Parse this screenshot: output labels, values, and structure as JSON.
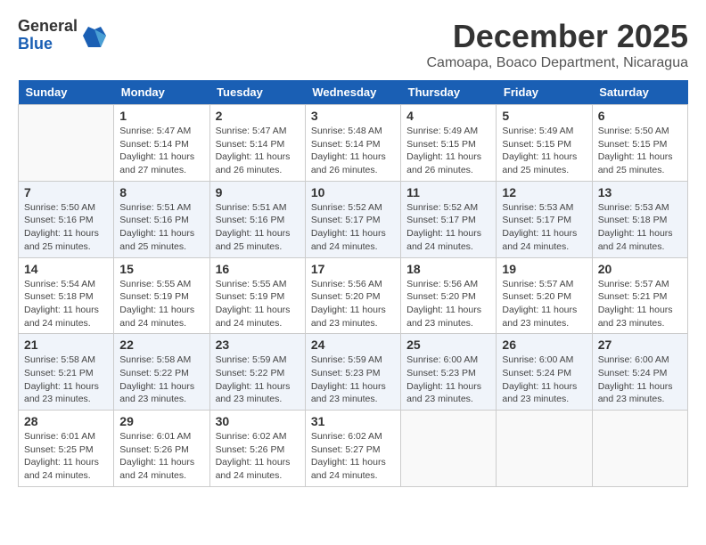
{
  "header": {
    "logo_general": "General",
    "logo_blue": "Blue",
    "month_title": "December 2025",
    "location": "Camoapa, Boaco Department, Nicaragua"
  },
  "weekdays": [
    "Sunday",
    "Monday",
    "Tuesday",
    "Wednesday",
    "Thursday",
    "Friday",
    "Saturday"
  ],
  "weeks": [
    [
      {
        "day": "",
        "info": ""
      },
      {
        "day": "1",
        "info": "Sunrise: 5:47 AM\nSunset: 5:14 PM\nDaylight: 11 hours\nand 27 minutes."
      },
      {
        "day": "2",
        "info": "Sunrise: 5:47 AM\nSunset: 5:14 PM\nDaylight: 11 hours\nand 26 minutes."
      },
      {
        "day": "3",
        "info": "Sunrise: 5:48 AM\nSunset: 5:14 PM\nDaylight: 11 hours\nand 26 minutes."
      },
      {
        "day": "4",
        "info": "Sunrise: 5:49 AM\nSunset: 5:15 PM\nDaylight: 11 hours\nand 26 minutes."
      },
      {
        "day": "5",
        "info": "Sunrise: 5:49 AM\nSunset: 5:15 PM\nDaylight: 11 hours\nand 25 minutes."
      },
      {
        "day": "6",
        "info": "Sunrise: 5:50 AM\nSunset: 5:15 PM\nDaylight: 11 hours\nand 25 minutes."
      }
    ],
    [
      {
        "day": "7",
        "info": "Sunrise: 5:50 AM\nSunset: 5:16 PM\nDaylight: 11 hours\nand 25 minutes."
      },
      {
        "day": "8",
        "info": "Sunrise: 5:51 AM\nSunset: 5:16 PM\nDaylight: 11 hours\nand 25 minutes."
      },
      {
        "day": "9",
        "info": "Sunrise: 5:51 AM\nSunset: 5:16 PM\nDaylight: 11 hours\nand 25 minutes."
      },
      {
        "day": "10",
        "info": "Sunrise: 5:52 AM\nSunset: 5:17 PM\nDaylight: 11 hours\nand 24 minutes."
      },
      {
        "day": "11",
        "info": "Sunrise: 5:52 AM\nSunset: 5:17 PM\nDaylight: 11 hours\nand 24 minutes."
      },
      {
        "day": "12",
        "info": "Sunrise: 5:53 AM\nSunset: 5:17 PM\nDaylight: 11 hours\nand 24 minutes."
      },
      {
        "day": "13",
        "info": "Sunrise: 5:53 AM\nSunset: 5:18 PM\nDaylight: 11 hours\nand 24 minutes."
      }
    ],
    [
      {
        "day": "14",
        "info": "Sunrise: 5:54 AM\nSunset: 5:18 PM\nDaylight: 11 hours\nand 24 minutes."
      },
      {
        "day": "15",
        "info": "Sunrise: 5:55 AM\nSunset: 5:19 PM\nDaylight: 11 hours\nand 24 minutes."
      },
      {
        "day": "16",
        "info": "Sunrise: 5:55 AM\nSunset: 5:19 PM\nDaylight: 11 hours\nand 24 minutes."
      },
      {
        "day": "17",
        "info": "Sunrise: 5:56 AM\nSunset: 5:20 PM\nDaylight: 11 hours\nand 23 minutes."
      },
      {
        "day": "18",
        "info": "Sunrise: 5:56 AM\nSunset: 5:20 PM\nDaylight: 11 hours\nand 23 minutes."
      },
      {
        "day": "19",
        "info": "Sunrise: 5:57 AM\nSunset: 5:20 PM\nDaylight: 11 hours\nand 23 minutes."
      },
      {
        "day": "20",
        "info": "Sunrise: 5:57 AM\nSunset: 5:21 PM\nDaylight: 11 hours\nand 23 minutes."
      }
    ],
    [
      {
        "day": "21",
        "info": "Sunrise: 5:58 AM\nSunset: 5:21 PM\nDaylight: 11 hours\nand 23 minutes."
      },
      {
        "day": "22",
        "info": "Sunrise: 5:58 AM\nSunset: 5:22 PM\nDaylight: 11 hours\nand 23 minutes."
      },
      {
        "day": "23",
        "info": "Sunrise: 5:59 AM\nSunset: 5:22 PM\nDaylight: 11 hours\nand 23 minutes."
      },
      {
        "day": "24",
        "info": "Sunrise: 5:59 AM\nSunset: 5:23 PM\nDaylight: 11 hours\nand 23 minutes."
      },
      {
        "day": "25",
        "info": "Sunrise: 6:00 AM\nSunset: 5:23 PM\nDaylight: 11 hours\nand 23 minutes."
      },
      {
        "day": "26",
        "info": "Sunrise: 6:00 AM\nSunset: 5:24 PM\nDaylight: 11 hours\nand 23 minutes."
      },
      {
        "day": "27",
        "info": "Sunrise: 6:00 AM\nSunset: 5:24 PM\nDaylight: 11 hours\nand 23 minutes."
      }
    ],
    [
      {
        "day": "28",
        "info": "Sunrise: 6:01 AM\nSunset: 5:25 PM\nDaylight: 11 hours\nand 24 minutes."
      },
      {
        "day": "29",
        "info": "Sunrise: 6:01 AM\nSunset: 5:26 PM\nDaylight: 11 hours\nand 24 minutes."
      },
      {
        "day": "30",
        "info": "Sunrise: 6:02 AM\nSunset: 5:26 PM\nDaylight: 11 hours\nand 24 minutes."
      },
      {
        "day": "31",
        "info": "Sunrise: 6:02 AM\nSunset: 5:27 PM\nDaylight: 11 hours\nand 24 minutes."
      },
      {
        "day": "",
        "info": ""
      },
      {
        "day": "",
        "info": ""
      },
      {
        "day": "",
        "info": ""
      }
    ]
  ]
}
